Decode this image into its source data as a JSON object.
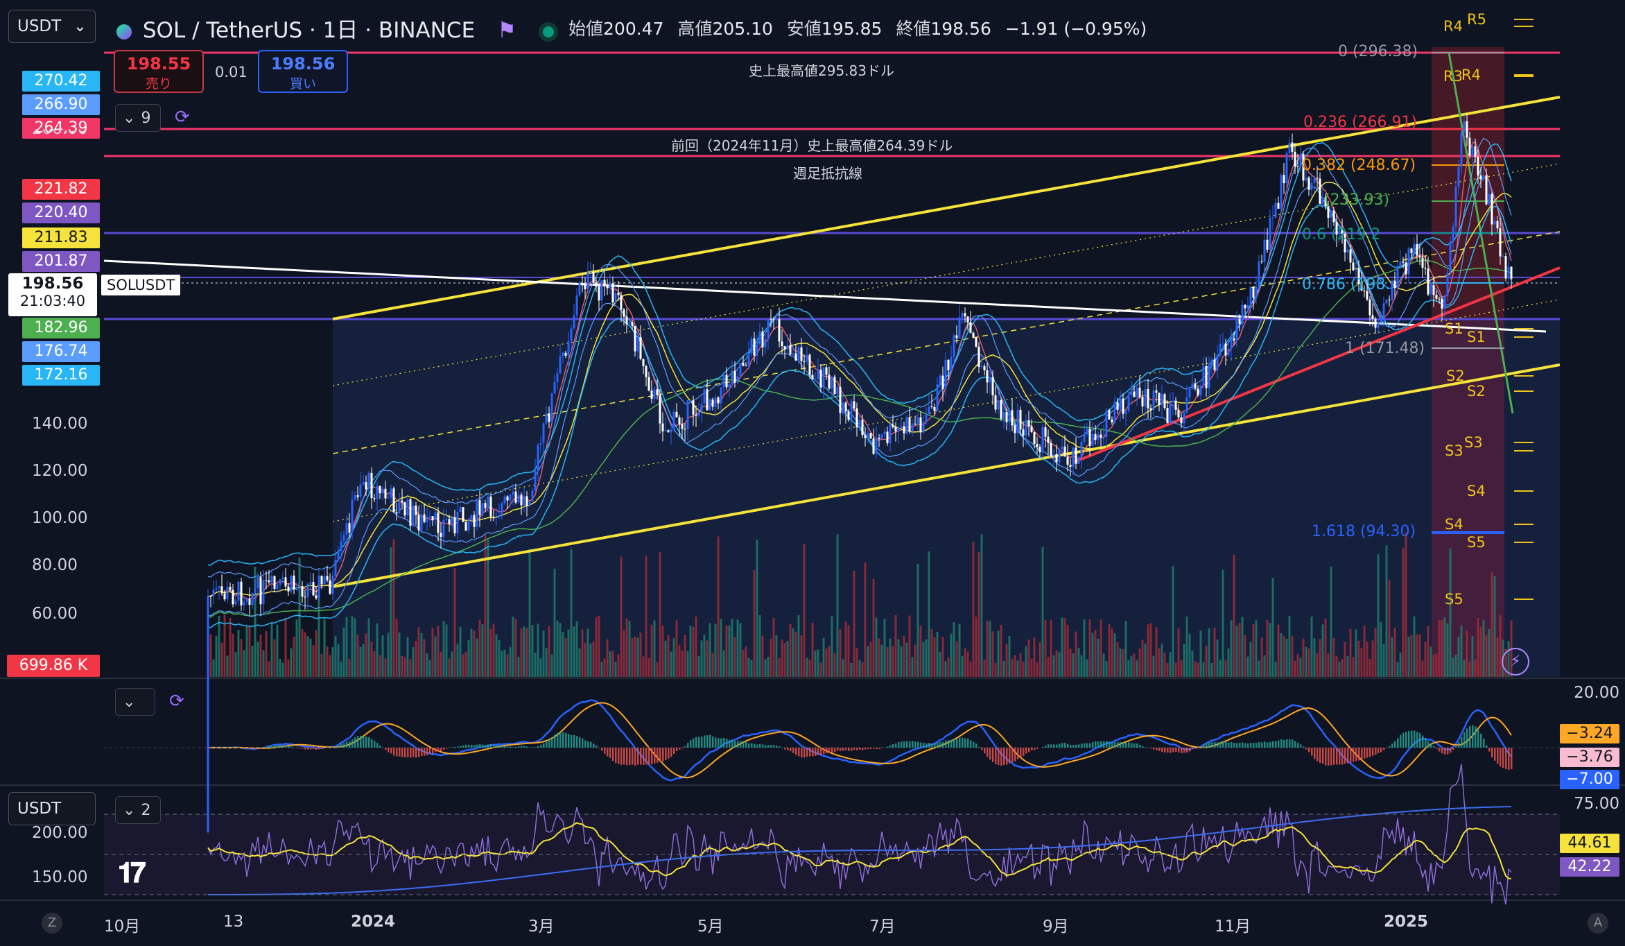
{
  "header": {
    "symbol_select": "USDT",
    "title": "SOL / TetherUS · 1日 · BINANCE",
    "ohlc": {
      "open_label": "始値",
      "open": "200.47",
      "high_label": "高値",
      "high": "205.10",
      "low_label": "安値",
      "low": "195.85",
      "close_label": "終値",
      "close": "198.56",
      "change": "−1.91 (−0.95%)"
    }
  },
  "trade": {
    "sell_price": "198.55",
    "sell_label": "売り",
    "spread": "0.01",
    "buy_price": "198.56",
    "buy_label": "買い"
  },
  "left_tags": [
    {
      "text": "270.42",
      "color": "#29b6f6"
    },
    {
      "text": "266.90",
      "color": "#5b9cff"
    },
    {
      "text": "264.39",
      "color": "#f23667"
    },
    {
      "text": "221.82",
      "color": "#f23645"
    },
    {
      "text": "220.40",
      "color": "#7e57c2"
    },
    {
      "text": "211.83",
      "color": "#f5e23a"
    },
    {
      "text": "201.87",
      "color": "#7e57c2"
    },
    {
      "text": "182.96",
      "color": "#4caf50"
    },
    {
      "text": "176.74",
      "color": "#5b9cff"
    },
    {
      "text": "172.16",
      "color": "#29b6f6"
    }
  ],
  "price_tag": {
    "price": "198.56",
    "countdown": "21:03:40",
    "symbol": "SOLUSDT"
  },
  "volume_tag": "699.86 K",
  "indicator_ctrl_main": "9",
  "indicator_ctrl_rsi": "2",
  "rsi_symbol_select": "USDT",
  "annotations": {
    "ath": "史上最高値295.83ドル",
    "prev_ath": "前回（2024年11月）史上最高値264.39ドル",
    "weekly_res": "週足抵抗線"
  },
  "fib_labels": [
    {
      "text": "0 (296.38)",
      "color": "#9598a1"
    },
    {
      "text": "0.236 (266.91)",
      "color": "#f23645"
    },
    {
      "text": "0.382 (248.67)",
      "color": "#ff9800"
    },
    {
      "text": "(233.93)",
      "color": "#4caf50"
    },
    {
      "text": "0.6 (219.2",
      "color": "#089981"
    },
    {
      "text": "0.786 (198.",
      "color": "#29b6f6"
    },
    {
      "text": "1 (171.48)",
      "color": "#9598a1"
    },
    {
      "text": "1.618 (94.30)",
      "color": "#2962ff"
    }
  ],
  "pivots": [
    "R5",
    "R4",
    "R4",
    "R3",
    "S1",
    "S1",
    "S2",
    "S2",
    "S3",
    "S3",
    "S4",
    "S4",
    "S5",
    "S5"
  ],
  "price_axis": [
    "140.00",
    "120.00",
    "100.00",
    "80.00",
    "60.00"
  ],
  "price_axis_partial": "200.00",
  "macd_axis": {
    "top": "20.00",
    "tags": [
      {
        "text": "−3.24",
        "color": "#ffa726"
      },
      {
        "text": "−3.76",
        "color": "#f8bbd0"
      },
      {
        "text": "−7.00",
        "color": "#2962ff"
      }
    ]
  },
  "rsi_axis": {
    "top": "75.00",
    "tags": [
      {
        "text": "44.61",
        "color": "#f5e23a"
      },
      {
        "text": "42.22",
        "color": "#7e57c2"
      }
    ],
    "left_partial": [
      "200.00",
      "150.00"
    ]
  },
  "time_axis": [
    "10月",
    "13",
    "2024",
    "3月",
    "5月",
    "7月",
    "9月",
    "11月",
    "2025"
  ],
  "corner_left": "Z",
  "corner_right": "A",
  "colors": {
    "bg": "#0e1422",
    "up": "#2962ff",
    "down": "#ffffff",
    "yellow": "#f5e23a",
    "pink": "#f23667",
    "purple": "#7e57c2"
  }
}
